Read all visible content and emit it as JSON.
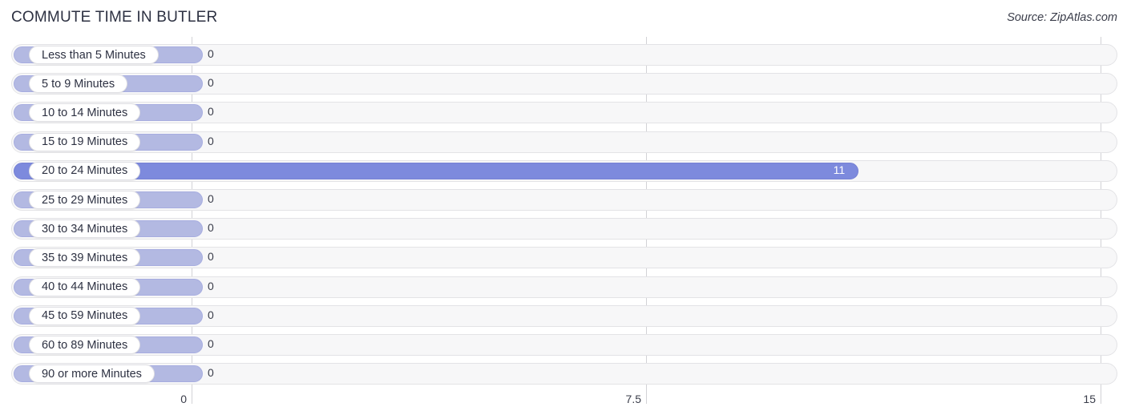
{
  "header": {
    "title": "COMMUTE TIME IN BUTLER",
    "source": "Source: ZipAtlas.com"
  },
  "colors": {
    "bar_default": "#b3b9e2",
    "bar_highlight": "#7d8add",
    "track_bg": "#f7f7f8",
    "track_border": "#e3e3e6",
    "title": "#2d3142",
    "gridline": "#d2d2d6"
  },
  "chart_data": {
    "type": "bar",
    "orientation": "horizontal",
    "title": "COMMUTE TIME IN BUTLER",
    "xlabel": "",
    "ylabel": "",
    "xlim": [
      0,
      15
    ],
    "xticks": [
      0,
      7.5,
      15
    ],
    "xtick_labels": [
      "0",
      "7.5",
      "15"
    ],
    "grid": true,
    "legend": null,
    "categories": [
      "Less than 5 Minutes",
      "5 to 9 Minutes",
      "10 to 14 Minutes",
      "15 to 19 Minutes",
      "20 to 24 Minutes",
      "25 to 29 Minutes",
      "30 to 34 Minutes",
      "35 to 39 Minutes",
      "40 to 44 Minutes",
      "45 to 59 Minutes",
      "60 to 89 Minutes",
      "90 or more Minutes"
    ],
    "values": [
      0,
      0,
      0,
      0,
      11,
      0,
      0,
      0,
      0,
      0,
      0,
      0
    ],
    "value_labels": [
      "0",
      "0",
      "0",
      "0",
      "11",
      "0",
      "0",
      "0",
      "0",
      "0",
      "0",
      "0"
    ],
    "highlight_index": 4
  },
  "rows": [
    {
      "label": "Less than 5 Minutes",
      "value": 0,
      "value_label": "0",
      "highlight": false
    },
    {
      "label": "5 to 9 Minutes",
      "value": 0,
      "value_label": "0",
      "highlight": false
    },
    {
      "label": "10 to 14 Minutes",
      "value": 0,
      "value_label": "0",
      "highlight": false
    },
    {
      "label": "15 to 19 Minutes",
      "value": 0,
      "value_label": "0",
      "highlight": false
    },
    {
      "label": "20 to 24 Minutes",
      "value": 11,
      "value_label": "11",
      "highlight": true
    },
    {
      "label": "25 to 29 Minutes",
      "value": 0,
      "value_label": "0",
      "highlight": false
    },
    {
      "label": "30 to 34 Minutes",
      "value": 0,
      "value_label": "0",
      "highlight": false
    },
    {
      "label": "35 to 39 Minutes",
      "value": 0,
      "value_label": "0",
      "highlight": false
    },
    {
      "label": "40 to 44 Minutes",
      "value": 0,
      "value_label": "0",
      "highlight": false
    },
    {
      "label": "45 to 59 Minutes",
      "value": 0,
      "value_label": "0",
      "highlight": false
    },
    {
      "label": "60 to 89 Minutes",
      "value": 0,
      "value_label": "0",
      "highlight": false
    },
    {
      "label": "90 or more Minutes",
      "value": 0,
      "value_label": "0",
      "highlight": false
    }
  ],
  "axis": {
    "ticks": [
      {
        "label": "0",
        "value": 0
      },
      {
        "label": "7.5",
        "value": 7.5
      },
      {
        "label": "15",
        "value": 15
      }
    ]
  }
}
